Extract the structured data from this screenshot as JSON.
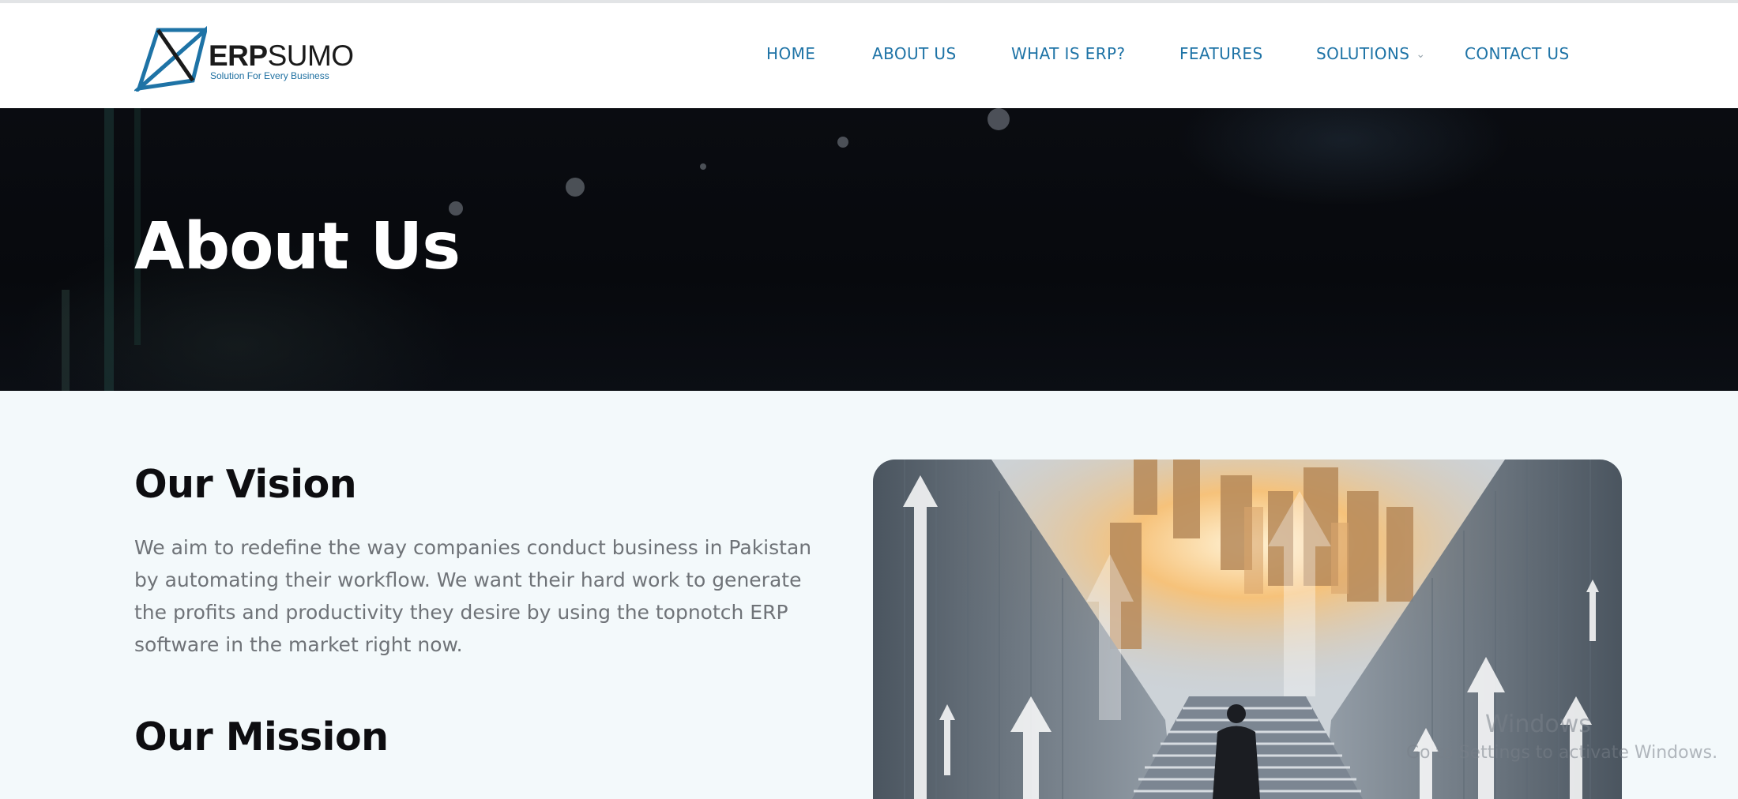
{
  "brand": {
    "name_bold": "ERP",
    "name_regular": "SUMO",
    "tagline": "Solution For Every Business",
    "primary_color": "#1e73a6"
  },
  "nav": {
    "items": [
      {
        "label": "HOME"
      },
      {
        "label": "ABOUT US"
      },
      {
        "label": "WHAT IS ERP?"
      },
      {
        "label": "FEATURES"
      },
      {
        "label": "SOLUTIONS",
        "icon": "chevron-down-icon"
      },
      {
        "label": "CONTACT US"
      }
    ]
  },
  "hero": {
    "title": "About Us"
  },
  "vision": {
    "heading": "Our Vision",
    "text": "We aim to redefine the way companies conduct business in Pakistan by automating their workflow. We want their hard work to generate the profits and productivity they desire by using the topnotch ERP software in the market right now."
  },
  "mission": {
    "heading": "Our Mission"
  },
  "photo": {
    "icon": "businessman-stairs-city-image"
  },
  "watermark": {
    "line1": "Windows",
    "line2": "Go to Settings to activate Windows."
  }
}
